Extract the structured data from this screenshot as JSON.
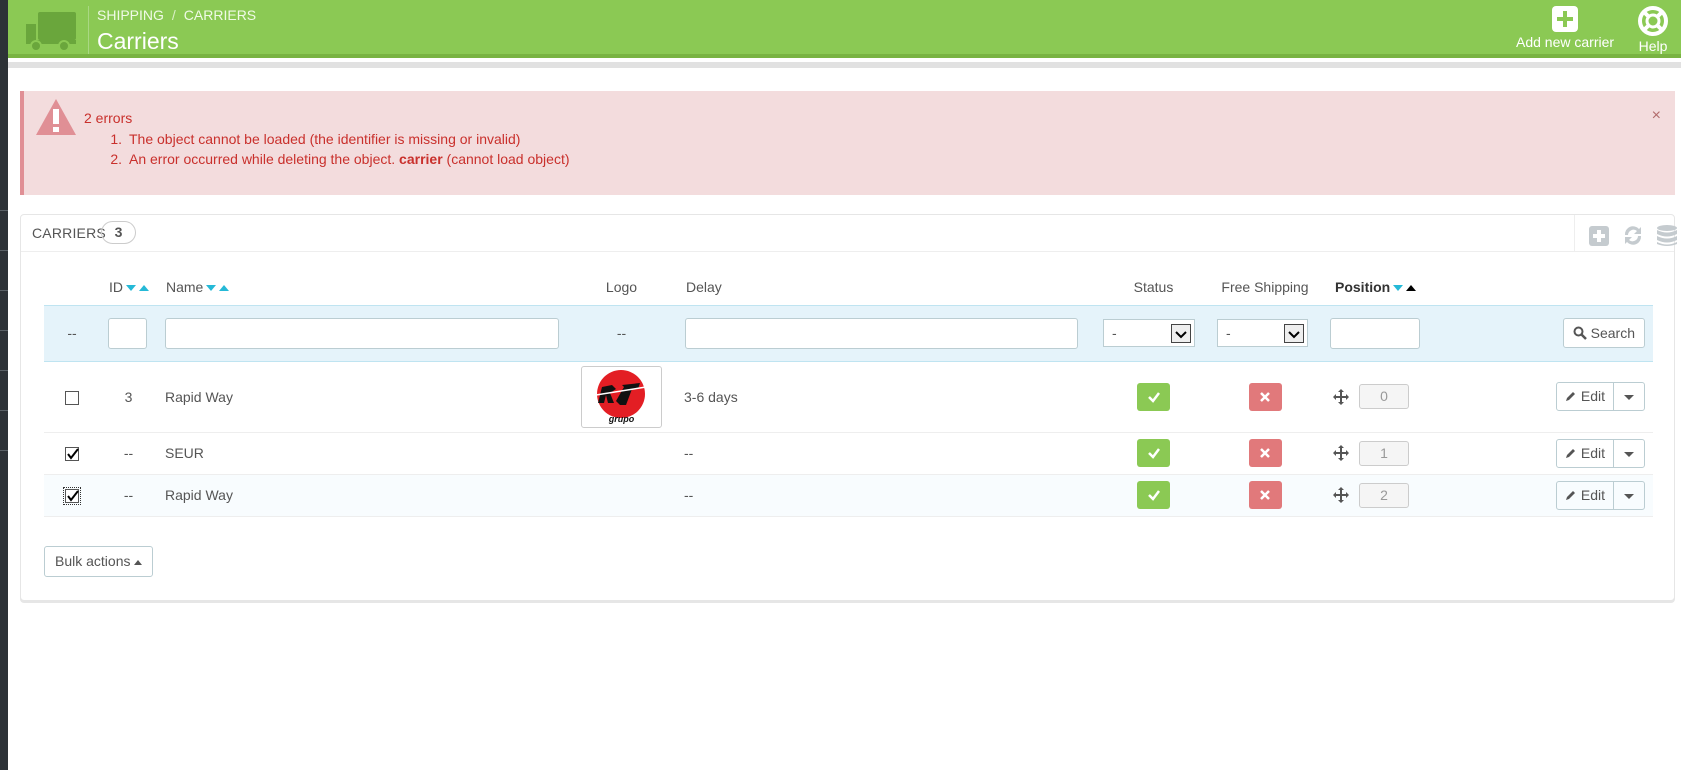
{
  "header": {
    "breadcrumb": [
      "SHIPPING",
      "CARRIERS"
    ],
    "breadcrumb_sep": "/",
    "title": "Carriers",
    "toolbar": {
      "add_label": "Add new carrier",
      "help_label": "Help"
    },
    "color": "#8bc954"
  },
  "alert": {
    "count_label": "2 errors",
    "errors": [
      {
        "num": "1.",
        "text": "The object cannot be loaded (the identifier is missing or invalid)"
      },
      {
        "num": "2.",
        "text_before": "An error occurred while deleting the object.",
        "bold": "carrier",
        "text_after": "(cannot load object)"
      }
    ],
    "close": "×"
  },
  "panel": {
    "title": "CARRIERS",
    "count": "3",
    "tools": [
      "add-icon",
      "refresh-icon",
      "database-icon"
    ]
  },
  "table": {
    "columns": {
      "id": "ID",
      "name": "Name",
      "logo": "Logo",
      "delay": "Delay",
      "status": "Status",
      "free_shipping": "Free Shipping",
      "position": "Position"
    },
    "filter": {
      "checkbox_placeholder": "--",
      "logo_placeholder": "--",
      "status_value": "-",
      "free_value": "-",
      "search_label": "Search"
    },
    "rows": [
      {
        "checked": false,
        "id": "3",
        "name": "Rapid Way",
        "has_logo": true,
        "logo_text": "grupo",
        "delay": "3-6 days",
        "status": "enabled",
        "free_shipping": "disabled",
        "position": "0",
        "edit_label": "Edit"
      },
      {
        "checked": true,
        "id": "--",
        "name": "SEUR",
        "has_logo": false,
        "delay": "--",
        "status": "enabled",
        "free_shipping": "disabled",
        "position": "1",
        "edit_label": "Edit"
      },
      {
        "checked": true,
        "id": "--",
        "name": "Rapid Way",
        "has_logo": false,
        "delay": "--",
        "status": "enabled",
        "free_shipping": "disabled",
        "position": "2",
        "edit_label": "Edit"
      }
    ]
  },
  "bulk_label": "Bulk actions"
}
